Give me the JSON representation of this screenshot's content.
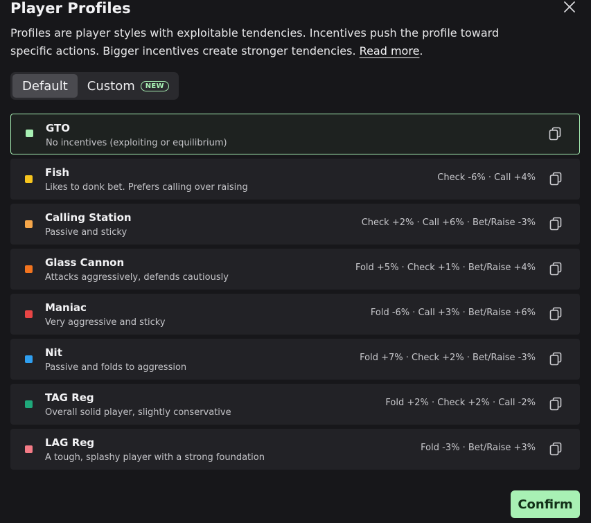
{
  "modal": {
    "title": "Player Profiles",
    "description": "Profiles are player styles with exploitable tendencies. Incentives push the profile toward specific actions. Bigger incentives create stronger tendencies.",
    "read_more": "Read more",
    "period": "."
  },
  "tabs": [
    {
      "label": "Default",
      "active": true
    },
    {
      "label": "Custom",
      "badge": "NEW",
      "active": false
    }
  ],
  "profiles": [
    {
      "name": "GTO",
      "description": "No incentives (exploiting or equilibrium)",
      "stats": "",
      "color": "#a8f0b4",
      "selected": true
    },
    {
      "name": "Fish",
      "description": "Likes to donk bet. Prefers calling over raising",
      "stats": "Check -6% · Call +4%",
      "color": "#f7c51e"
    },
    {
      "name": "Calling Station",
      "description": "Passive and sticky",
      "stats": "Check +2% · Call +6% · Bet/Raise -3%",
      "color": "#f5a64a"
    },
    {
      "name": "Glass Cannon",
      "description": "Attacks aggressively, defends cautiously",
      "stats": "Fold +5% · Check +1% · Bet/Raise +4%",
      "color": "#f2741f"
    },
    {
      "name": "Maniac",
      "description": "Very aggressive and sticky",
      "stats": "Fold -6% · Call +3% · Bet/Raise +6%",
      "color": "#e84545"
    },
    {
      "name": "Nit",
      "description": "Passive and folds to aggression",
      "stats": "Fold +7% · Check +2% · Bet/Raise -3%",
      "color": "#2f9ff0"
    },
    {
      "name": "TAG Reg",
      "description": "Overall solid player, slightly conservative",
      "stats": "Fold +2% · Check +2% · Call -2%",
      "color": "#1fa87a"
    },
    {
      "name": "LAG Reg",
      "description": "A tough, splashy player with a strong foundation",
      "stats": "Fold -3% · Bet/Raise +3%",
      "color": "#f47b86"
    }
  ],
  "footer": {
    "confirm_label": "Confirm"
  },
  "icons": {
    "close": "close-icon",
    "copy": "copy-icon"
  }
}
